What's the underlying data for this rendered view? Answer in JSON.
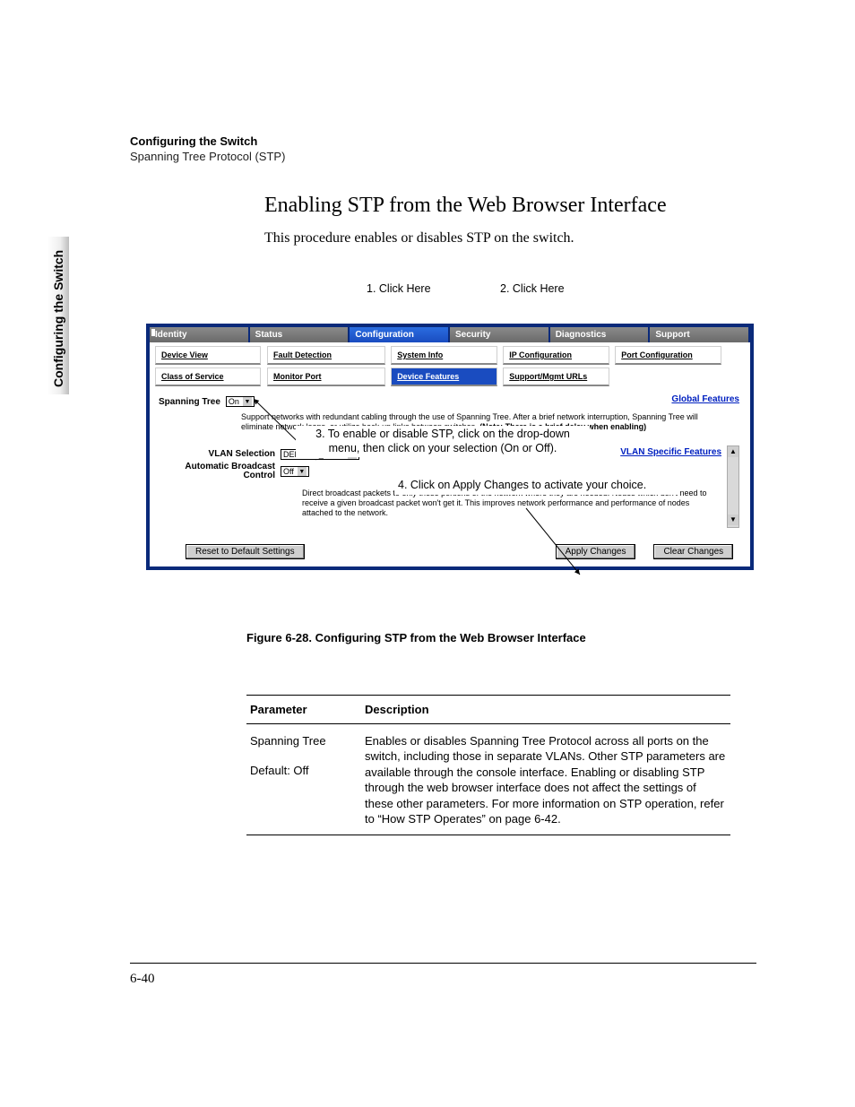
{
  "header": {
    "bold": "Configuring the Switch",
    "light": "Spanning Tree Protocol (STP)"
  },
  "side_tab": "Configuring the Switch",
  "section": {
    "title": "Enabling STP from the Web Browser Interface",
    "intro": "This procedure enables or disables STP on the switch."
  },
  "callouts": {
    "c1": "1. Click Here",
    "c2": "2. Click Here",
    "c3": "3. To enable or disable STP, click on the drop-down menu, then click on your selection (On or Off).",
    "c4": "4. Click on Apply Changes to activate your choice."
  },
  "tabs": [
    "Identity",
    "Status",
    "Configuration",
    "Security",
    "Diagnostics",
    "Support"
  ],
  "subtabs_row1": [
    "Device View",
    "Fault Detection",
    "System Info",
    "IP Configuration",
    "Port Configuration"
  ],
  "subtabs_row2": [
    "Class of Service",
    "Monitor Port",
    "Device Features",
    "Support/Mgmt URLs"
  ],
  "panel": {
    "spanning_tree_label": "Spanning Tree",
    "spanning_tree_value": "On",
    "global_link": "Global Features",
    "stp_desc_prefix": "Support networks with redundant cabling through the use of Spanning Tree. After a brief network interruption, Spanning Tree will eliminate network loops, or utilize back-up links between switches. ",
    "stp_desc_bold": "(Note: There is a brief delay when enabling)",
    "vlan_link": "VLAN Specific Features",
    "vlan_selection_label": "VLAN Selection",
    "vlan_selection_value": "DEFAULT_VLAN",
    "abc_label": "Automatic Broadcast Control",
    "abc_value": "Off",
    "abc_desc": "Direct broadcast packets to only those portions of the network where they are needed. Nodes which don't need to receive a given broadcast packet won't get it. This improves network performance and performance of nodes attached to the network."
  },
  "buttons": {
    "reset": "Reset to Default Settings",
    "apply": "Apply Changes",
    "clear": "Clear Changes"
  },
  "figure_caption": "Figure 6-28.  Configuring STP from the Web Browser Interface",
  "param_table": {
    "h1": "Parameter",
    "h2": "Description",
    "p_name": "Spanning Tree",
    "p_default": "Default: Off",
    "p_desc": "Enables or disables Spanning Tree Protocol across all ports on the switch, including those in separate VLANs. Other STP parameters are available through the console interface. Enabling or disabling STP through the web browser interface does not affect the settings of these other parameters. For more information on STP operation, refer to “How STP Operates” on page 6-42."
  },
  "page_number": "6-40"
}
